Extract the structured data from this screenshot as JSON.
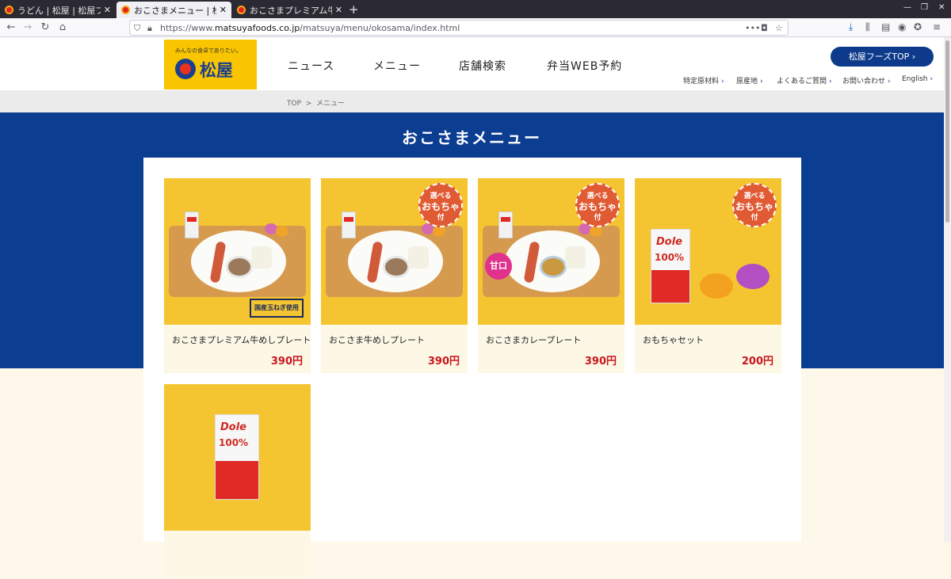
{
  "browser": {
    "tabs": [
      {
        "title": "うどん | 松屋 | 松屋フーズ",
        "active": false
      },
      {
        "title": "おこさまメニュー | 松屋",
        "active": true
      },
      {
        "title": "おこさまプレミアム牛め",
        "active": false
      }
    ],
    "url_prefix": "https://www.",
    "url_domain": "matsuyafoods.co.jp",
    "url_path": "/matsuya/menu/okosama/index.html"
  },
  "header": {
    "logo_tagline": "みんなの食卓でありたい。",
    "logo_name": "松屋",
    "nav": [
      "ニュース",
      "メニュー",
      "店舗検索",
      "弁当WEB予約"
    ],
    "corporate_button": "松屋フーズTOP",
    "sub_links": [
      "特定原材料",
      "原産地",
      "よくあるご質問",
      "お問い合わせ",
      "English"
    ]
  },
  "breadcrumb": {
    "home": "TOP",
    "separator": ">",
    "current": "メニュー"
  },
  "page_title": "おこさまメニュー",
  "products": [
    {
      "name": "おこさまプレミアム牛めしプレート",
      "price": "390円",
      "badge": "国産玉ねぎ使用"
    },
    {
      "name": "おこさま牛めしプレート",
      "price": "390円",
      "badge": "選べる おもちゃ 付"
    },
    {
      "name": "おこさまカレープレート",
      "price": "390円",
      "badge": "選べる おもちゃ 付",
      "badge2": "甘口"
    },
    {
      "name": "おもちゃセット",
      "price": "200円",
      "badge": "選べる おもちゃ 付"
    },
    {
      "name": "",
      "price": "",
      "badge": ""
    }
  ],
  "badge_toy": {
    "line1": "選べる",
    "line2": "おもちゃ",
    "line3": "付"
  },
  "colors": {
    "brand_blue": "#0b3d91",
    "brand_yellow": "#f8c500",
    "price_red": "#c8161d"
  }
}
